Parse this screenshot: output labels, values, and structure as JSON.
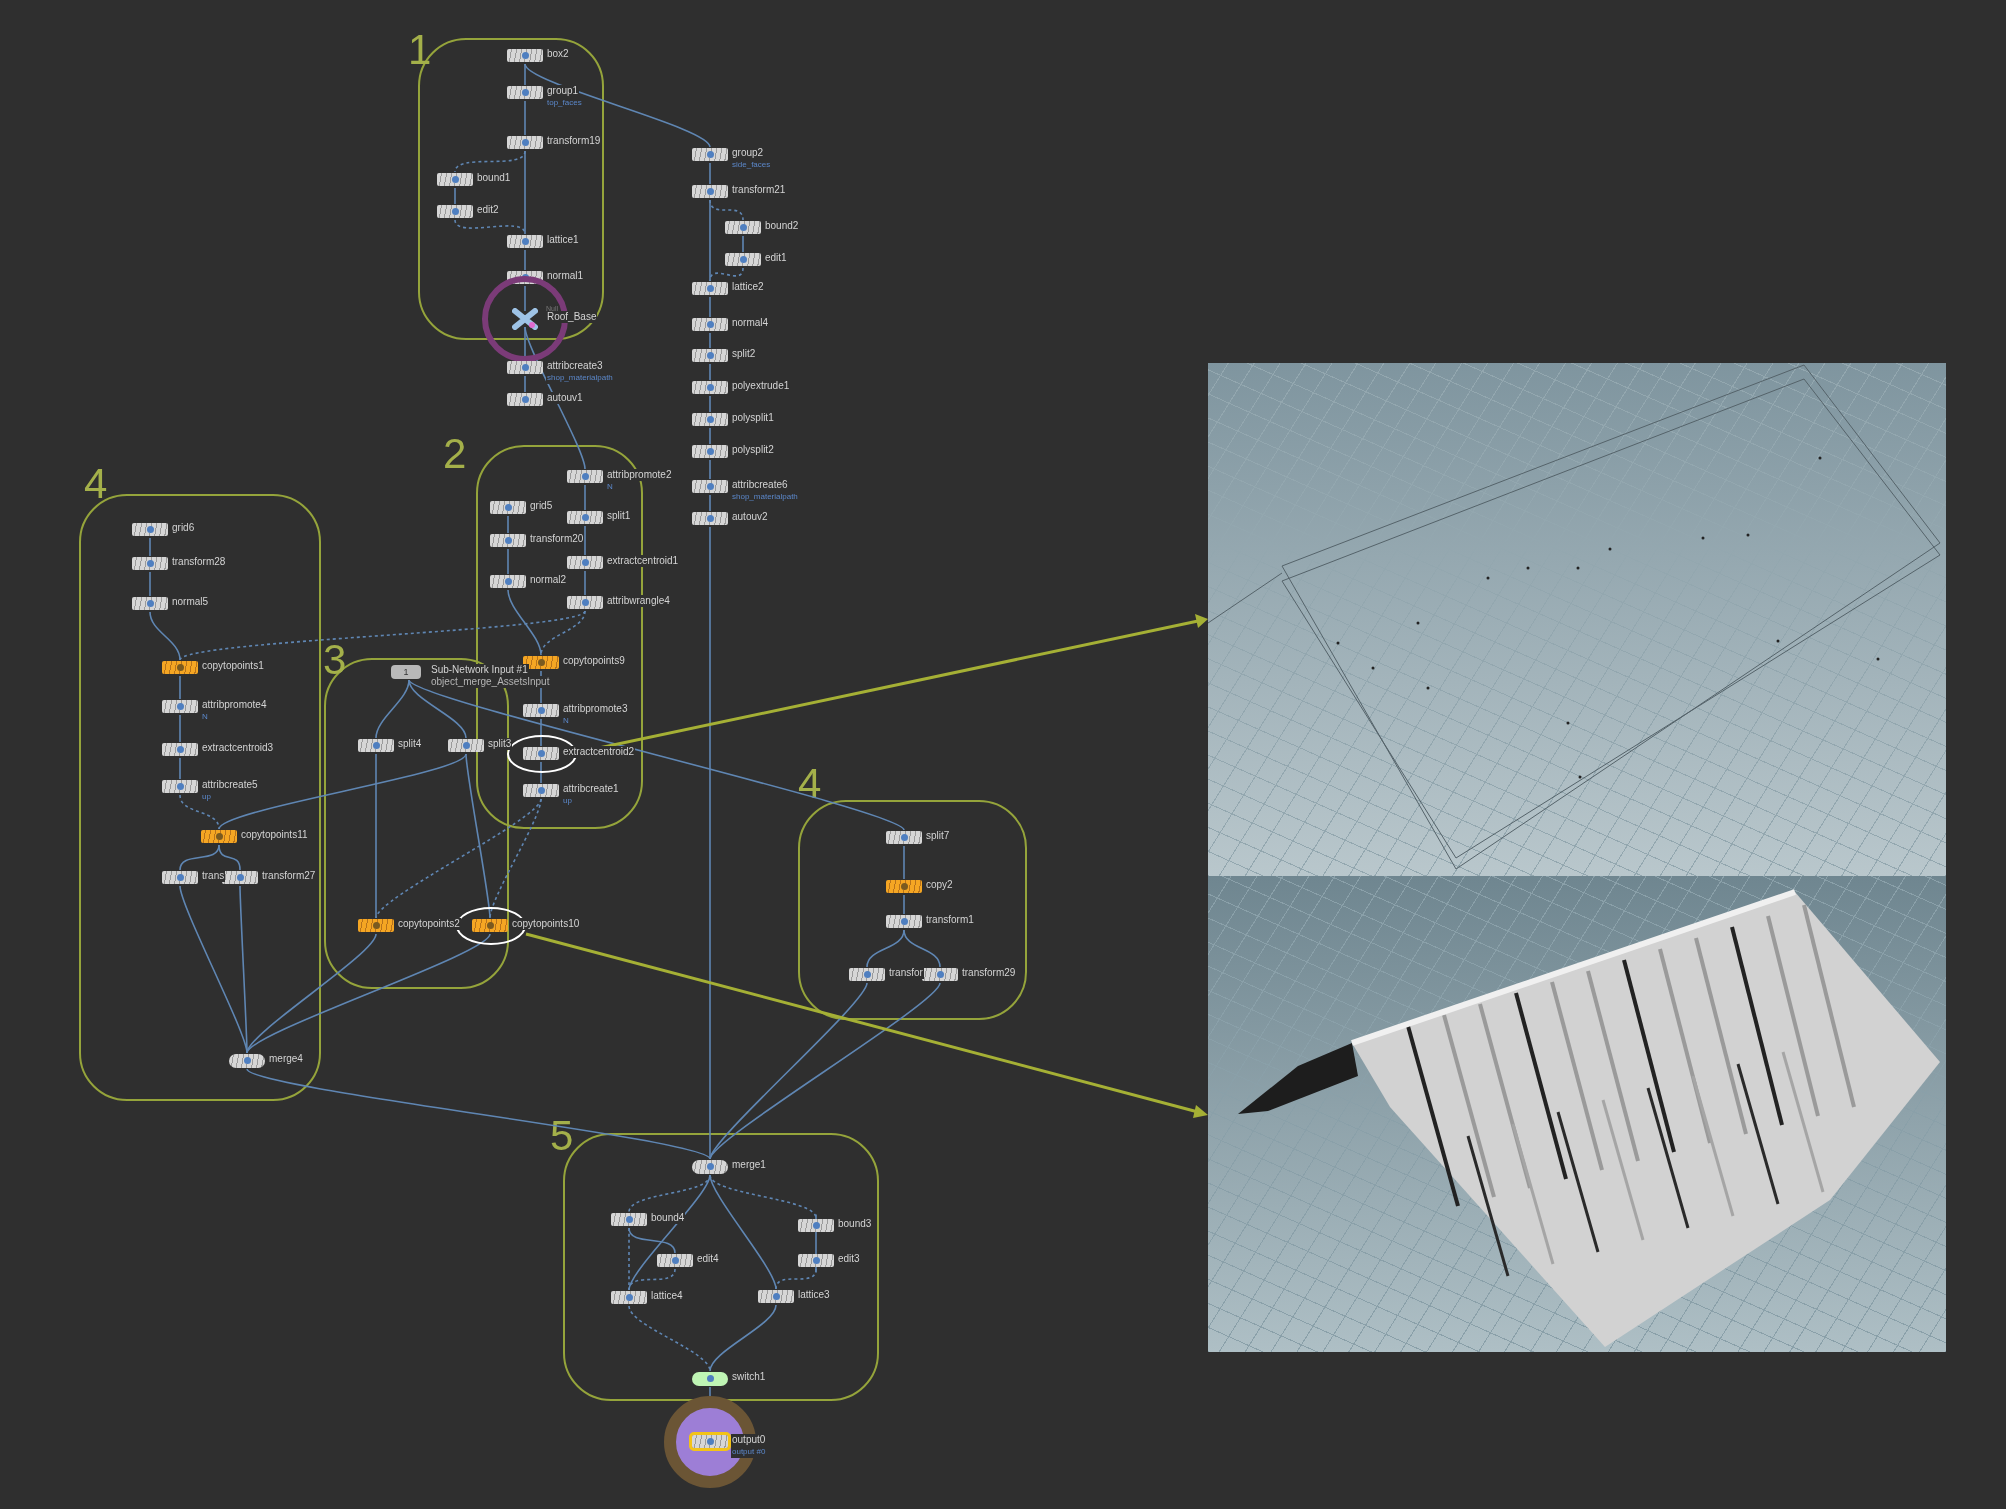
{
  "groups": [
    {
      "label": "1"
    },
    {
      "label": "2"
    },
    {
      "label": "3"
    },
    {
      "label": "4"
    },
    {
      "label": "4"
    },
    {
      "label": "5"
    }
  ],
  "nodes": [
    {
      "name": "box2",
      "kind": "sop",
      "circled": false
    },
    {
      "name": "group1",
      "sublabel": "top_faces",
      "kind": "sop",
      "circled": false
    },
    {
      "name": "transform19",
      "kind": "sop",
      "circled": false
    },
    {
      "name": "bound1",
      "kind": "sop",
      "circled": false
    },
    {
      "name": "edit2",
      "kind": "sop",
      "circled": false
    },
    {
      "name": "lattice1",
      "kind": "sop",
      "circled": false
    },
    {
      "name": "normal1",
      "kind": "sop",
      "circled": false
    },
    {
      "name": "Roof_Base",
      "type_label": "Null",
      "kind": "null",
      "circled": false
    },
    {
      "name": "attribcreate3",
      "sublabel": "shop_materialpath",
      "kind": "sop",
      "circled": false
    },
    {
      "name": "autouv1",
      "kind": "sop",
      "circled": false
    },
    {
      "name": "group2",
      "sublabel": "side_faces",
      "kind": "sop",
      "circled": false
    },
    {
      "name": "transform21",
      "kind": "sop",
      "circled": false
    },
    {
      "name": "bound2",
      "kind": "sop",
      "circled": false
    },
    {
      "name": "edit1",
      "kind": "sop",
      "circled": false
    },
    {
      "name": "lattice2",
      "kind": "sop",
      "circled": false
    },
    {
      "name": "normal4",
      "kind": "sop",
      "circled": false
    },
    {
      "name": "split2",
      "kind": "sop",
      "circled": false
    },
    {
      "name": "polyextrude1",
      "kind": "sop",
      "circled": false
    },
    {
      "name": "polysplit1",
      "kind": "sop",
      "circled": false
    },
    {
      "name": "polysplit2",
      "kind": "sop",
      "circled": false
    },
    {
      "name": "attribcreate6",
      "sublabel": "shop_materialpath",
      "kind": "sop",
      "circled": false
    },
    {
      "name": "autouv2",
      "kind": "sop",
      "circled": false
    },
    {
      "name": "attribpromote2",
      "sublabel": "N",
      "kind": "sop",
      "circled": false
    },
    {
      "name": "grid5",
      "kind": "sop",
      "circled": false
    },
    {
      "name": "split1",
      "kind": "sop",
      "circled": false
    },
    {
      "name": "transform20",
      "kind": "sop",
      "circled": false
    },
    {
      "name": "extractcentroid1",
      "kind": "sop",
      "circled": false
    },
    {
      "name": "normal2",
      "kind": "sop",
      "circled": false
    },
    {
      "name": "attribwrangle4",
      "kind": "sop",
      "circled": false
    },
    {
      "name": "copytopoints9",
      "kind": "copy",
      "circled": false
    },
    {
      "name": "attribpromote3",
      "sublabel": "N",
      "kind": "sop",
      "circled": false
    },
    {
      "name": "extractcentroid2",
      "kind": "sop",
      "circled": true
    },
    {
      "name": "attribcreate1",
      "sublabel": "up",
      "kind": "sop",
      "circled": false
    },
    {
      "name": "Sub-Network Input #1",
      "index": "1",
      "sublabel": "object_merge_AssetsInput",
      "kind": "subnet",
      "circled": false
    },
    {
      "name": "split4",
      "kind": "sop",
      "circled": false
    },
    {
      "name": "split3",
      "kind": "sop",
      "circled": false
    },
    {
      "name": "copytopoints2",
      "kind": "copy",
      "circled": false
    },
    {
      "name": "copytopoints10",
      "kind": "copy",
      "circled": true
    },
    {
      "name": "grid6",
      "kind": "sop",
      "circled": false
    },
    {
      "name": "transform28",
      "kind": "sop",
      "circled": false
    },
    {
      "name": "normal5",
      "kind": "sop",
      "circled": false
    },
    {
      "name": "copytopoints1",
      "kind": "copy",
      "circled": false
    },
    {
      "name": "attribpromote4",
      "sublabel": "N",
      "kind": "sop",
      "circled": false
    },
    {
      "name": "extractcentroid3",
      "kind": "sop",
      "circled": false
    },
    {
      "name": "attribcreate5",
      "sublabel": "up",
      "kind": "sop",
      "circled": false
    },
    {
      "name": "copytopoints11",
      "kind": "copy",
      "circled": false
    },
    {
      "name": "trans",
      "kind": "sop",
      "circled": false
    },
    {
      "name": "transform27",
      "kind": "sop",
      "circled": false
    },
    {
      "name": "merge4",
      "kind": "merge",
      "circled": false
    },
    {
      "name": "split7",
      "kind": "sop",
      "circled": false
    },
    {
      "name": "copy2",
      "kind": "copy",
      "circled": false
    },
    {
      "name": "transform1",
      "kind": "sop",
      "circled": false
    },
    {
      "name": "transfor",
      "kind": "sop",
      "circled": false
    },
    {
      "name": "transform29",
      "kind": "sop",
      "circled": false
    },
    {
      "name": "merge1",
      "kind": "merge",
      "circled": false
    },
    {
      "name": "bound4",
      "kind": "sop",
      "circled": false
    },
    {
      "name": "bound3",
      "kind": "sop",
      "circled": false
    },
    {
      "name": "edit4",
      "kind": "sop",
      "circled": false
    },
    {
      "name": "edit3",
      "kind": "sop",
      "circled": false
    },
    {
      "name": "lattice4",
      "kind": "sop",
      "circled": false
    },
    {
      "name": "lattice3",
      "kind": "sop",
      "circled": false
    },
    {
      "name": "switch1",
      "kind": "switch",
      "circled": false
    },
    {
      "name": "output0",
      "sublabel": "output #0",
      "kind": "output",
      "circled": false
    }
  ]
}
